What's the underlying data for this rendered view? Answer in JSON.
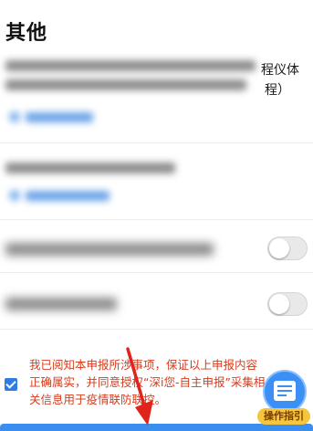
{
  "section": {
    "title": "其他"
  },
  "row1": {
    "visible_tail_line1": "程仪体",
    "visible_tail_line2": "程）"
  },
  "toggles": [
    {
      "id": "toggle-1",
      "on": false
    },
    {
      "id": "toggle-2",
      "on": false
    }
  ],
  "agreement": {
    "checked": true,
    "text": "我已阅知本申报所涉事项，保证以上申报内容正确属实，并同意授权“深i您-自主申报”采集相关信息用于疫情联防联控。"
  },
  "guide": {
    "label": "操作指引",
    "icon": "document-icon"
  },
  "colors": {
    "accent": "#3a8ef0",
    "warning_text": "#d63c1e",
    "checkbox": "#2f7de1",
    "arrow": "#e0231b"
  }
}
